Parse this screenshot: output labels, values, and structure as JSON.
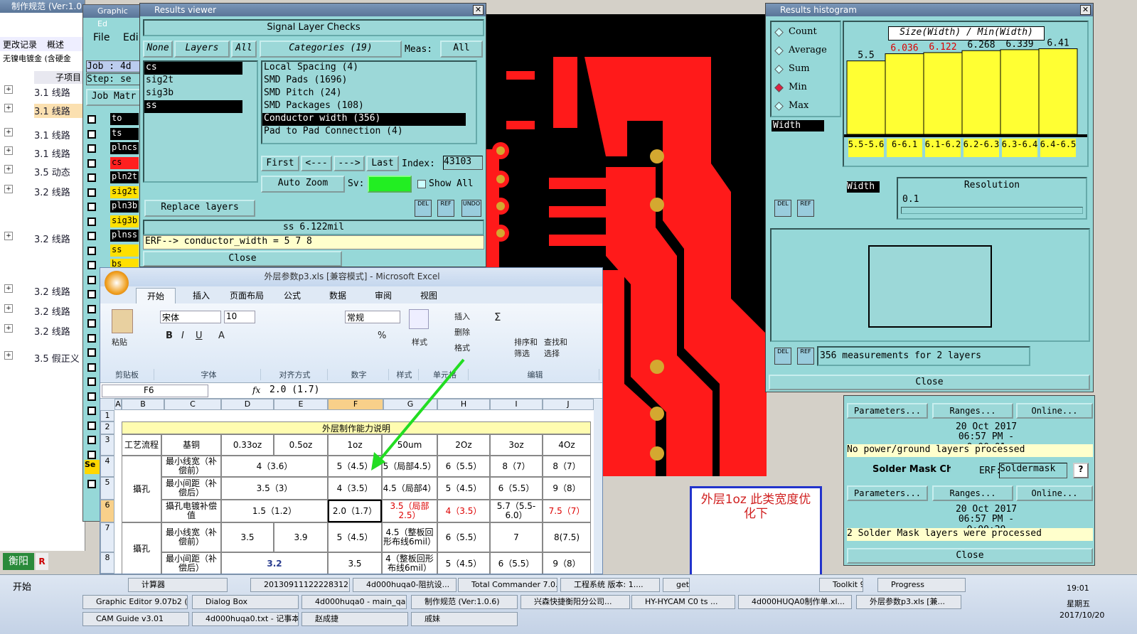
{
  "left_app": {
    "title": "制作规范 (Ver:1.0",
    "menu": [
      "更改记录",
      "概述",
      "子项目"
    ],
    "filter": "无镍电镀金 (含硬金",
    "rows": [
      "3.1 线路",
      "3.1 线路",
      "3.1 线路",
      "3.1 线路",
      "3.5 动态",
      "3.2 线路",
      "3.2 线路",
      "3.2 线路",
      "3.2 线路",
      "3.2 线路",
      "3.5 假正义"
    ],
    "header_col": "子项目",
    "bottom_labels": [
      "衡阳",
      "R"
    ]
  },
  "graphic_editor": {
    "title": "Graphic Ed",
    "menu": [
      "File",
      "Edi"
    ],
    "job": "Job : 4d",
    "step": "Step: se",
    "job_matrix": "Job Matr",
    "layers": [
      "to",
      "ts",
      "plncs",
      "cs",
      "pln2t",
      "sig2t",
      "pln3b",
      "sig3b",
      "plnss",
      "ss",
      "bs"
    ],
    "sel": "Se"
  },
  "results_viewer": {
    "title": "Results viewer",
    "header": "Signal Layer Checks",
    "btn_none": "None",
    "btn_layers": "Layers",
    "btn_all": "All",
    "categories_label": "Categories (19)",
    "meas_label": "Meas:",
    "meas_value": "All",
    "layers_list": [
      "cs",
      "sig2t",
      "sig3b",
      "ss"
    ],
    "categories": [
      "Local Spacing (4)",
      "SMD Pads (1696)",
      "SMD Pitch (24)",
      "SMD Packages (108)",
      "Conductor width (356)",
      "Pad to Pad Connection (4)"
    ],
    "btn_first": "First",
    "btn_prev": "<---",
    "btn_next": "--->",
    "btn_last": "Last",
    "index_label": "Index:",
    "index_value": "43103",
    "auto_zoom": "Auto Zoom",
    "sv_label": "Sv:",
    "show_all": "Show All",
    "replace_layers": "Replace layers",
    "status": "ss 6.122mil",
    "erf": "ERF--> conductor_width = 5 7 8",
    "close": "Close",
    "icons": [
      "DEL",
      "REF",
      "UNDO"
    ]
  },
  "histogram": {
    "title": "Results histogram",
    "options": [
      "Count",
      "Average",
      "Sum",
      "Min",
      "Max"
    ],
    "selected_option": "Min",
    "chart_title": "Size(Width) / Min(Width)",
    "attr": "Width",
    "attr2": "Width",
    "resolution_label": "Resolution",
    "resolution_value": "0.1",
    "measurements": "356 measurements for 2 layers",
    "close": "Close",
    "icons": [
      "DEL",
      "REF"
    ]
  },
  "chart_data": {
    "type": "bar",
    "title": "Size(Width) / Min(Width)",
    "categories": [
      "5.5-5.6",
      "6-6.1",
      "6.1-6.2",
      "6.2-6.3",
      "6.3-6.4",
      "6.4-6.5"
    ],
    "values": [
      5.5,
      6.036,
      6.122,
      6.268,
      6.339,
      6.41
    ],
    "value_labels": [
      "5.5",
      "6.036",
      "6.122",
      "6.268",
      "6.339",
      "6.41"
    ],
    "red_labels": [
      false,
      true,
      true,
      false,
      false,
      false
    ],
    "ylim": [
      0,
      6.6
    ],
    "bar_color": "#ffff33"
  },
  "progress": {
    "params": "Parameters...",
    "ranges": "Ranges...",
    "online": "Online...",
    "date1": "20 Oct 2017",
    "time1": "06:57 PM - 0:00:01",
    "status1": "No power/ground layers processed",
    "solder": "Solder Mask Ch",
    "erf_label": "ERF:",
    "erf_value": "Soldermask",
    "help": "?",
    "date2": "20 Oct 2017",
    "time2": "06:57 PM - 0:00:20",
    "status2": "2 Solder Mask layers were processed",
    "close": "Close"
  },
  "excel": {
    "title": "外层参数p3.xls [兼容模式] - Microsoft Excel",
    "tabs": [
      "开始",
      "插入",
      "页面布局",
      "公式",
      "数据",
      "审阅",
      "视图"
    ],
    "font": "宋体",
    "size": "10",
    "number_fmt": "常规",
    "groups": [
      "剪贴板",
      "字体",
      "对齐方式",
      "数字",
      "样式",
      "单元格",
      "编辑"
    ],
    "paste": "粘贴",
    "style": "样式",
    "cell_btns": [
      "插入",
      "删除",
      "格式"
    ],
    "edit_btns": [
      "排序和筛选",
      "查找和选择"
    ],
    "namebox": "F6",
    "fx": "fx",
    "formula": "2.0 (1.7)",
    "cols": [
      "A",
      "B",
      "C",
      "D",
      "E",
      "F",
      "G",
      "H",
      "I",
      "J"
    ],
    "rows": [
      "1",
      "2",
      "3",
      "4",
      "5",
      "6",
      "7",
      "8"
    ],
    "table_title": "外层制作能力说明",
    "header": [
      "工艺流程",
      "基铜",
      "0.33oz",
      "0.5oz",
      "1oz",
      "50um",
      "2Oz",
      "3oz",
      "4Oz"
    ],
    "row_label": "攝孔",
    "r4": [
      "最小线宽（补偿前）",
      "4（3.6）",
      "5（4.5）",
      "5（局部4.5）",
      "6（5.5）",
      "8（7）",
      "8（7）"
    ],
    "r5": [
      "最小间距（补偿后）",
      "3.5（3）",
      "4（3.5）",
      "4.5（局部4）",
      "5（4.5）",
      "6（5.5）",
      "9（8）"
    ],
    "r6": [
      "攝孔电镀补偿值",
      "1.5（1.2）",
      "2.0（1.7）",
      "3.5（局部2.5）",
      "4（3.5）",
      "5.7（5.5-6.0）",
      "7.5（7）"
    ],
    "r7": [
      "最小线宽（补偿前）",
      "3.5",
      "3.9",
      "5（4.5）",
      "4.5（整板回形布线6mil）",
      "6（5.5）",
      "7",
      "8(7.5)"
    ],
    "r8": [
      "最小间距（补偿后）",
      "3.2",
      "3.5",
      "4（整板回形布线6mil）",
      "5（4.5）",
      "6（5.5）",
      "9（8）"
    ]
  },
  "note": "外层1oz  此类宽度优化下",
  "taskbar": {
    "start": "开始",
    "row1": [
      "计算器",
      "20130911122228312...",
      "4d000huqa0-阻抗设...",
      "Total Commander 7.0...",
      "工程系统 版本: 1....",
      "get",
      "Toolkit 9....",
      "Progress"
    ],
    "row2": [
      "Graphic Editor 9.07b2 (0...",
      "Dialog Box",
      "4d000huqa0 - main_qa",
      "制作规范 (Ver:1.0.6)",
      "兴森快捷衡阳分公司...",
      "HY-HYCAM C0 ts ...",
      "4d000HUQA0制作单.xl...",
      "外层参数p3.xls [兼..."
    ],
    "row3": [
      "CAM Guide v3.01",
      "4d000huqa0.txt - 记事本",
      "赵成捷",
      "戚妹"
    ],
    "time": "19:01",
    "weekday": "星期五",
    "date": "2017/10/20"
  }
}
